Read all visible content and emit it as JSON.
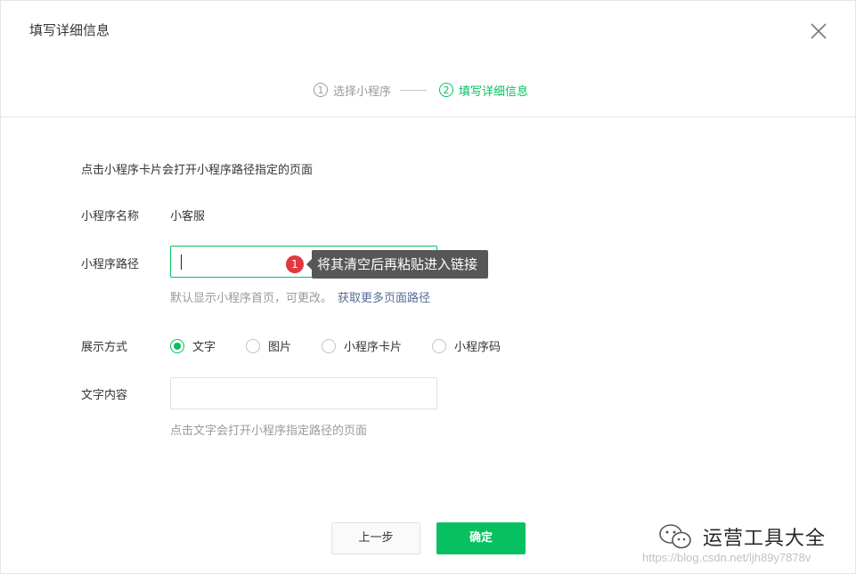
{
  "dialog": {
    "title": "填写详细信息"
  },
  "steps": [
    {
      "num": "1",
      "label": "选择小程序",
      "state": "inactive"
    },
    {
      "num": "2",
      "label": "填写详细信息",
      "state": "active"
    }
  ],
  "form": {
    "description": "点击小程序卡片会打开小程序路径指定的页面",
    "name_label": "小程序名称",
    "name_value": "小客服",
    "path_label": "小程序路径",
    "path_value": "",
    "path_hint": "默认显示小程序首页，可更改。",
    "path_hint_link": "获取更多页面路径",
    "display_label": "展示方式",
    "display_options": [
      {
        "label": "文字",
        "checked": true
      },
      {
        "label": "图片",
        "checked": false
      },
      {
        "label": "小程序卡片",
        "checked": false
      },
      {
        "label": "小程序码",
        "checked": false
      }
    ],
    "text_label": "文字内容",
    "text_value": "",
    "text_hint": "点击文字会打开小程序指定路径的页面"
  },
  "tooltip": {
    "badge": "1",
    "text": "将其清空后再粘贴进入链接"
  },
  "buttons": {
    "prev": "上一步",
    "confirm": "确定"
  },
  "watermark": {
    "brand": "运营工具大全",
    "url": "https://blog.csdn.net/ljh89y7878v"
  },
  "colors": {
    "accent": "#07c160",
    "link": "#576b95",
    "badge": "#e0383e",
    "tooltip_bg": "#575757"
  },
  "icons": {
    "close": "close-icon",
    "wechat": "wechat-logo-icon"
  }
}
